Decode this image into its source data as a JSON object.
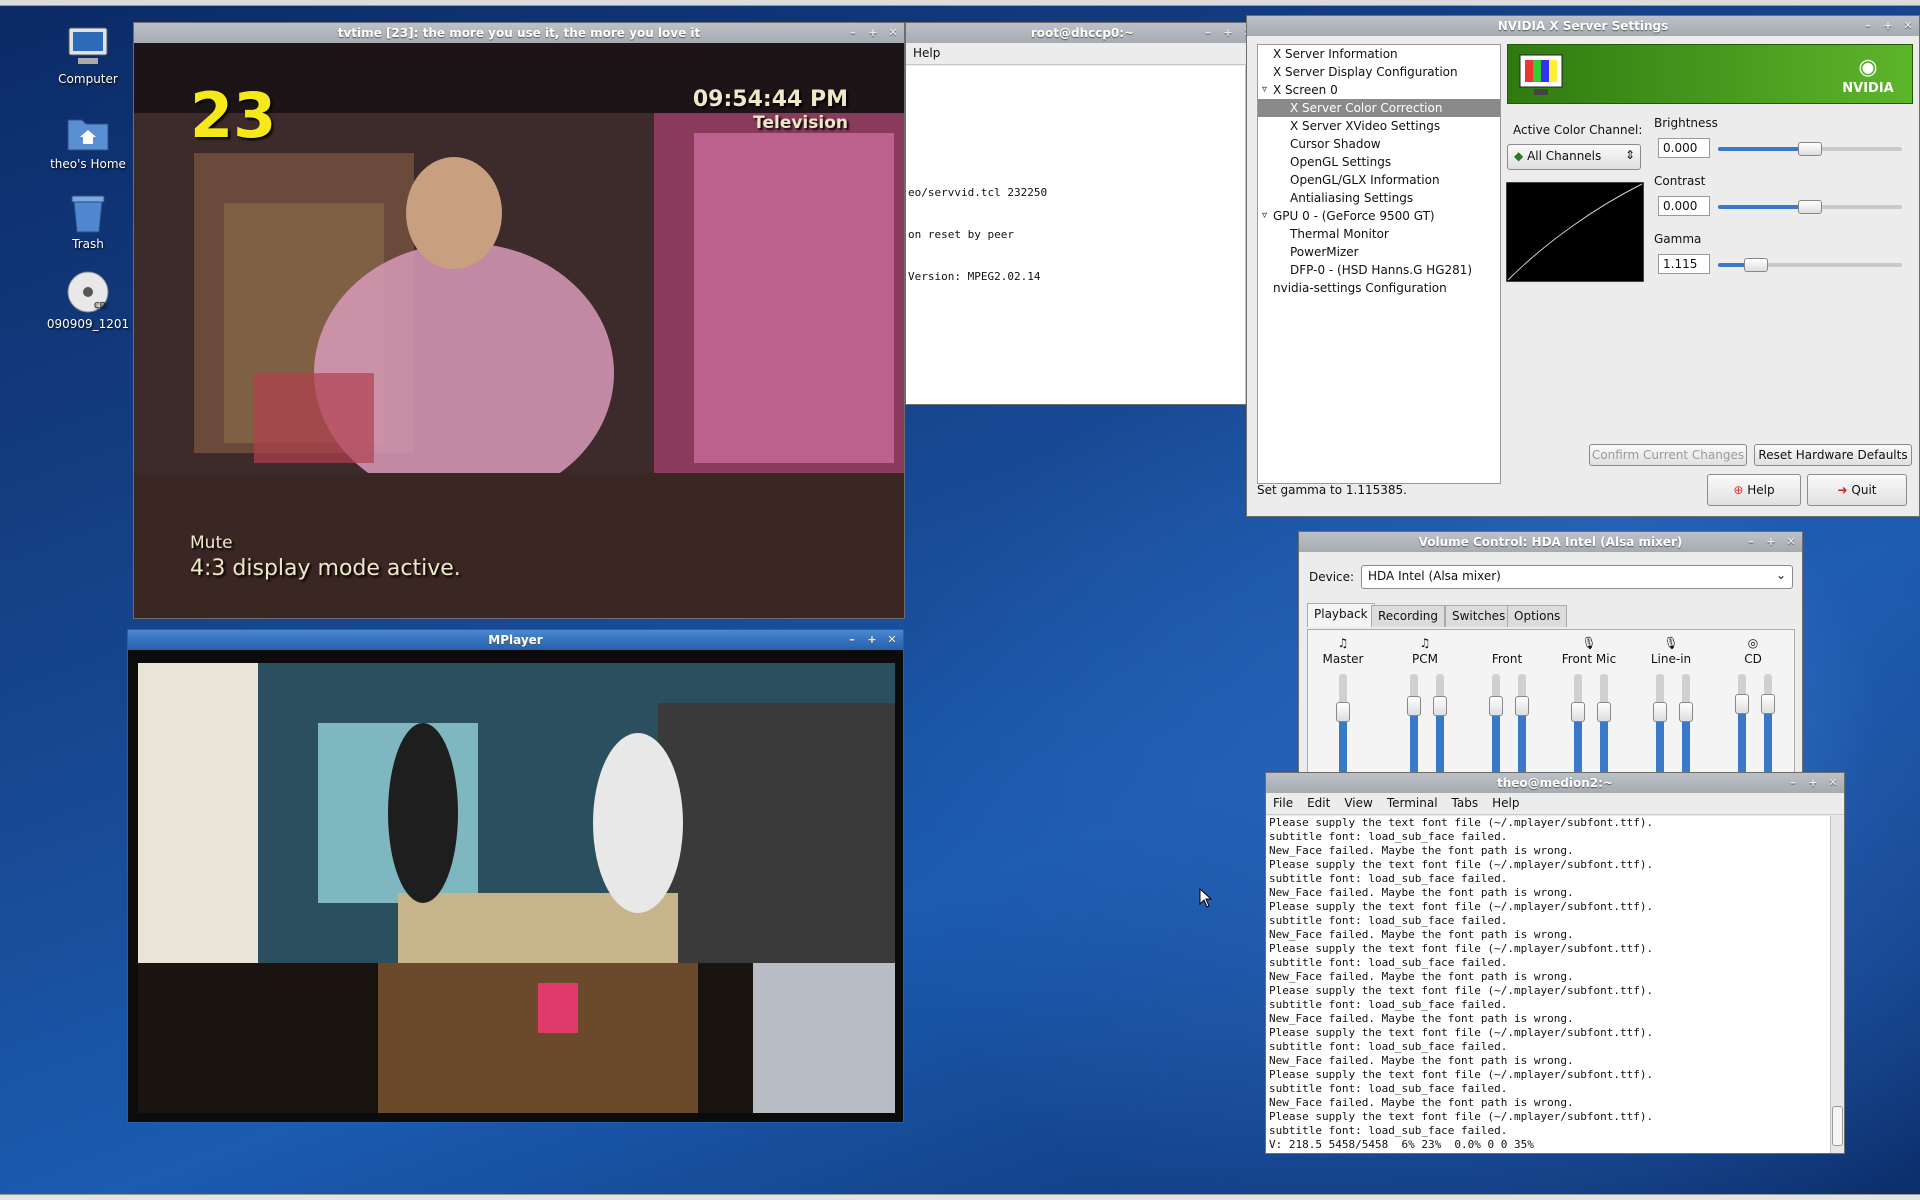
{
  "desktop": {
    "icons": [
      {
        "label": "Computer",
        "icon": "computer-icon"
      },
      {
        "label": "theo's Home",
        "icon": "home-folder-icon"
      },
      {
        "label": "Trash",
        "icon": "trash-icon"
      },
      {
        "label": "090909_1201",
        "icon": "cd-icon"
      }
    ]
  },
  "tvtime": {
    "title": "tvtime [23]: the more you use it, the more you love it",
    "channel": "23",
    "time": "09:54:44 PM",
    "source": "Television",
    "status1": "Mute",
    "status2": "4:3 display mode active."
  },
  "term1": {
    "title": "root@dhccp0:~",
    "menu_help": "Help",
    "lines": [
      "eo/servvid.tcl 232250",
      "on reset by peer",
      "Version: MPEG2.02.14"
    ]
  },
  "nvidia": {
    "title": "NVIDIA X Server Settings",
    "tree": [
      {
        "label": "X Server Information",
        "indent": 0
      },
      {
        "label": "X Server Display Configuration",
        "indent": 0
      },
      {
        "label": "X Screen 0",
        "indent": 0,
        "expander": "▿"
      },
      {
        "label": "X Server Color Correction",
        "indent": 1,
        "selected": true
      },
      {
        "label": "X Server XVideo Settings",
        "indent": 1
      },
      {
        "label": "Cursor Shadow",
        "indent": 1
      },
      {
        "label": "OpenGL Settings",
        "indent": 1
      },
      {
        "label": "OpenGL/GLX Information",
        "indent": 1
      },
      {
        "label": "Antialiasing Settings",
        "indent": 1
      },
      {
        "label": "GPU 0 - (GeForce 9500 GT)",
        "indent": 0,
        "expander": "▿"
      },
      {
        "label": "Thermal Monitor",
        "indent": 1
      },
      {
        "label": "PowerMizer",
        "indent": 1
      },
      {
        "label": "DFP-0 - (HSD Hanns.G HG281)",
        "indent": 1
      },
      {
        "label": "nvidia-settings Configuration",
        "indent": 0
      }
    ],
    "logo_text": "NVIDIA",
    "active_channel_label": "Active Color Channel:",
    "channel_value": "All Channels",
    "brightness_label": "Brightness",
    "brightness_value": "0.000",
    "brightness_level": 0.5,
    "contrast_label": "Contrast",
    "contrast_value": "0.000",
    "contrast_level": 0.5,
    "gamma_label": "Gamma",
    "gamma_value": "1.115",
    "gamma_level": 0.16,
    "confirm_label": "Confirm Current Changes",
    "reset_label": "Reset Hardware Defaults",
    "status": "Set gamma to 1.115385.",
    "help_label": "Help",
    "quit_label": "Quit"
  },
  "mplayer": {
    "title": "MPlayer"
  },
  "volume": {
    "title": "Volume Control: HDA Intel (Alsa mixer)",
    "device_label": "Device:",
    "device_value": "HDA Intel (Alsa mixer)",
    "tabs": [
      "Playback",
      "Recording",
      "Switches",
      "Options"
    ],
    "channels": [
      {
        "label": "Master",
        "icon": "♫",
        "stereo": false,
        "level": 0.72
      },
      {
        "label": "PCM",
        "icon": "♫",
        "stereo": true,
        "level": 0.78
      },
      {
        "label": "Front",
        "icon": "",
        "stereo": true,
        "level": 0.78
      },
      {
        "label": "Front Mic",
        "icon": "🎙",
        "stereo": true,
        "level": 0.72
      },
      {
        "label": "Line-in",
        "icon": "🎙",
        "stereo": true,
        "level": 0.72
      },
      {
        "label": "CD",
        "icon": "◎",
        "stereo": true,
        "level": 0.8
      }
    ]
  },
  "term2": {
    "title": "theo@medion2:~",
    "menus": [
      "File",
      "Edit",
      "View",
      "Terminal",
      "Tabs",
      "Help"
    ],
    "lines": [
      "Please supply the text font file (~/.mplayer/subfont.ttf).",
      "subtitle font: load_sub_face failed.",
      "New_Face failed. Maybe the font path is wrong.",
      "Please supply the text font file (~/.mplayer/subfont.ttf).",
      "subtitle font: load_sub_face failed.",
      "New_Face failed. Maybe the font path is wrong.",
      "Please supply the text font file (~/.mplayer/subfont.ttf).",
      "subtitle font: load_sub_face failed.",
      "New_Face failed. Maybe the font path is wrong.",
      "Please supply the text font file (~/.mplayer/subfont.ttf).",
      "subtitle font: load_sub_face failed.",
      "New_Face failed. Maybe the font path is wrong.",
      "Please supply the text font file (~/.mplayer/subfont.ttf).",
      "subtitle font: load_sub_face failed.",
      "New_Face failed. Maybe the font path is wrong.",
      "Please supply the text font file (~/.mplayer/subfont.ttf).",
      "subtitle font: load_sub_face failed.",
      "New_Face failed. Maybe the font path is wrong.",
      "Please supply the text font file (~/.mplayer/subfont.ttf).",
      "subtitle font: load_sub_face failed.",
      "New_Face failed. Maybe the font path is wrong.",
      "Please supply the text font file (~/.mplayer/subfont.ttf).",
      "subtitle font: load_sub_face failed.",
      "V: 218.5 5458/5458  6% 23%  0.0% 0 0 35%"
    ]
  },
  "colors": {
    "accent": "#2560ad",
    "nvidia_green": "#3f9a17",
    "osd_yellow": "#f5e81b"
  }
}
